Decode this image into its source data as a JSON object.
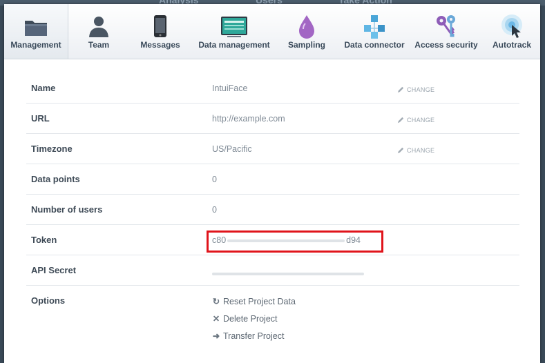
{
  "backdrop": {
    "left_text": "Analysis",
    "mid_text": "Users",
    "right_text": "Take Action"
  },
  "tabs": [
    {
      "label": "Management",
      "icon": "folder-icon",
      "active": true
    },
    {
      "label": "Team",
      "icon": "person-icon"
    },
    {
      "label": "Messages",
      "icon": "phone-icon"
    },
    {
      "label": "Data management",
      "icon": "monitor-icon"
    },
    {
      "label": "Sampling",
      "icon": "droplet-icon"
    },
    {
      "label": "Data connector",
      "icon": "cubes-icon"
    },
    {
      "label": "Access security",
      "icon": "keys-icon"
    },
    {
      "label": "Autotrack",
      "icon": "cursor-target-icon"
    }
  ],
  "settings": {
    "name": {
      "label": "Name",
      "value": "IntuiFace",
      "change": "CHANGE"
    },
    "url": {
      "label": "URL",
      "value": "http://example.com",
      "change": "CHANGE"
    },
    "timezone": {
      "label": "Timezone",
      "value": "US/Pacific",
      "change": "CHANGE"
    },
    "data_points": {
      "label": "Data points",
      "value": "0"
    },
    "users": {
      "label": "Number of users",
      "value": "0"
    },
    "token": {
      "label": "Token",
      "prefix": "c80",
      "suffix": "d94"
    },
    "api_secret": {
      "label": "API Secret"
    },
    "options": {
      "label": "Options",
      "reset": "Reset Project Data",
      "delete": "Delete Project",
      "transfer": "Transfer Project"
    }
  },
  "colors": {
    "highlight": "#e0141b",
    "text_label": "#3e4a56",
    "text_value": "#7f8a95"
  }
}
